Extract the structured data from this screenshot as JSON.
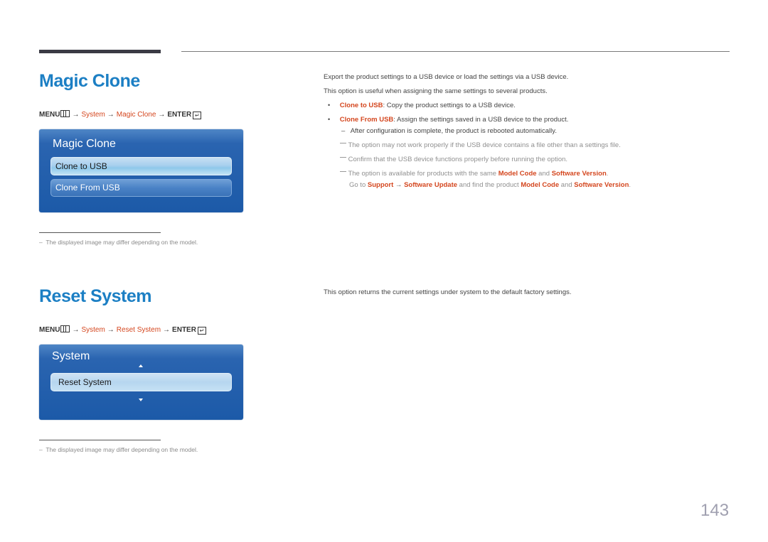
{
  "page_number": "143",
  "sections": [
    {
      "title": "Magic Clone",
      "path": {
        "menu": "MENU",
        "arrow": "→",
        "system": "System",
        "item": "Magic Clone",
        "enter": "ENTER",
        "enter_glyph": "↵"
      },
      "osd": {
        "title": "Magic Clone",
        "items": [
          {
            "label": "Clone to USB",
            "state": "selected"
          },
          {
            "label": "Clone From USB",
            "state": "normal"
          }
        ]
      },
      "footnote": "The displayed image may differ depending on the model.",
      "description": [
        "Export the product settings to a USB device or load the settings via a USB device.",
        "This option is useful when assigning the same settings to several products."
      ],
      "bullets": [
        {
          "term": "Clone to USB",
          "text": ": Copy the product settings to a USB device."
        },
        {
          "term": "Clone From USB",
          "text": ": Assign the settings saved in a USB device to the product."
        }
      ],
      "sub_note": "After configuration is complete, the product is rebooted automatically.",
      "notes": [
        "The option may not work properly if the USB device contains a file other than a settings file.",
        "Confirm that the USB device functions properly before running the option."
      ],
      "note3": {
        "prefix": "The option is available for products with the same ",
        "model_code": "Model Code",
        "and": " and ",
        "software_version": "Software Version",
        "period": ".",
        "line2_prefix": "Go to ",
        "support": "Support",
        "arrow": " → ",
        "software_update": "Software Update",
        "line2_mid": " and find the product "
      }
    },
    {
      "title": "Reset System",
      "path": {
        "menu": "MENU",
        "arrow": "→",
        "system": "System",
        "item": "Reset System",
        "enter": "ENTER",
        "enter_glyph": "↵"
      },
      "osd": {
        "title": "System",
        "items": [
          {
            "label": "Reset System",
            "state": "selected"
          }
        ]
      },
      "footnote": "The displayed image may differ depending on the model.",
      "description": [
        "This option returns the current settings under system to the default factory settings."
      ]
    }
  ],
  "dash": "–",
  "bullet_glyph": "•"
}
